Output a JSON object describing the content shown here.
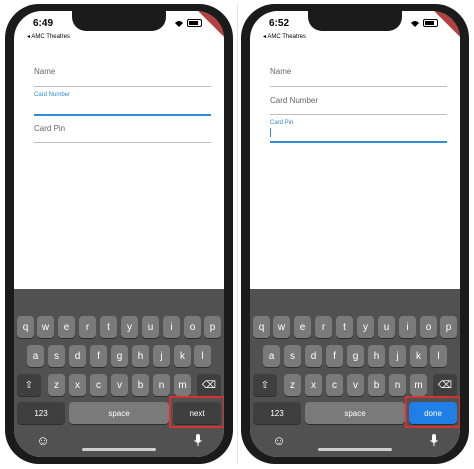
{
  "left": {
    "time": "6:49",
    "carrier": "◂ AMC Theatres",
    "fields": {
      "name": "Name",
      "card_number": "Card Number",
      "card_pin": "Card Pin"
    },
    "action_key": "next"
  },
  "right": {
    "time": "6:52",
    "carrier": "◂ AMC Theatres",
    "fields": {
      "name": "Name",
      "card_number": "Card Number",
      "card_pin": "Card Pin"
    },
    "action_key": "done"
  },
  "keyboard": {
    "row1": [
      "q",
      "w",
      "e",
      "r",
      "t",
      "y",
      "u",
      "i",
      "o",
      "p"
    ],
    "row2": [
      "a",
      "s",
      "d",
      "f",
      "g",
      "h",
      "j",
      "k",
      "l"
    ],
    "row3": [
      "z",
      "x",
      "c",
      "v",
      "b",
      "n",
      "m"
    ],
    "numbers_label": "123",
    "space_label": "space",
    "shift_icon": "⇧",
    "delete_icon": "⌫",
    "emoji_icon": "☺",
    "mic_icon": "🎤"
  },
  "colors": {
    "accent": "#2f8bd6",
    "done_key": "#1f7fe6",
    "highlight": "#d93030",
    "keyboard_bg": "#515151",
    "key_bg": "#7a7a7a"
  }
}
